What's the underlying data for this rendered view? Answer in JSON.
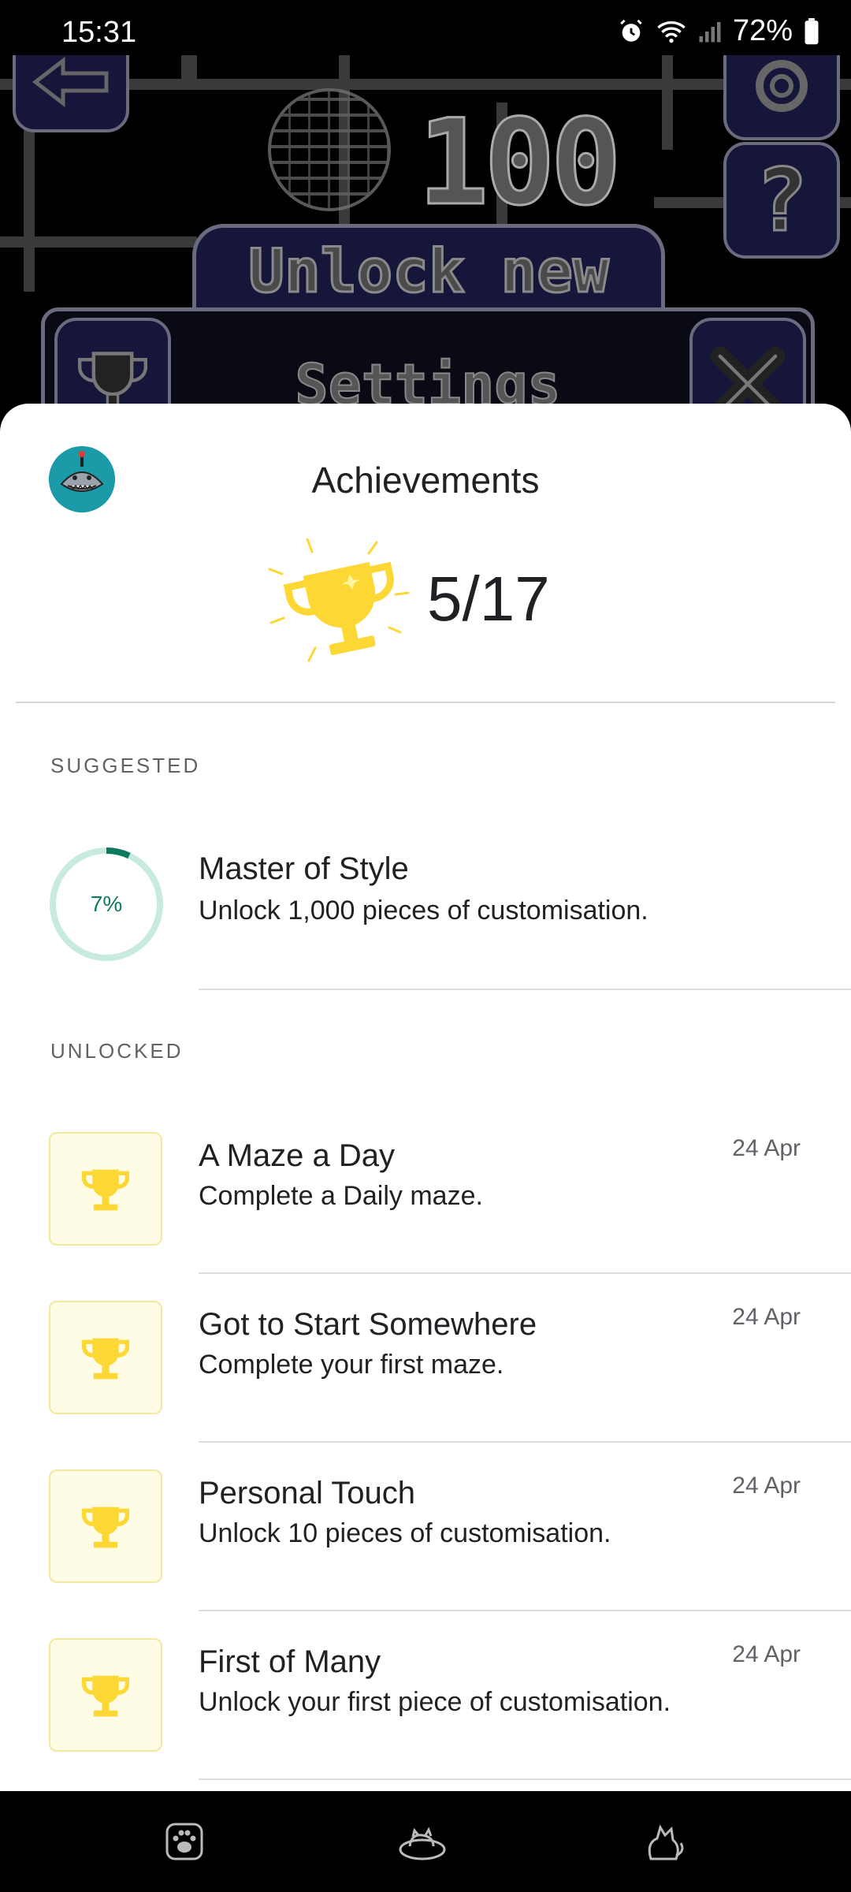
{
  "status_bar": {
    "time": "15:31",
    "battery": "72%",
    "icons": [
      "alarm-icon",
      "wifi-icon",
      "signal-icon",
      "battery-icon"
    ]
  },
  "background_game": {
    "score": "100",
    "banner_text": "Unlock new",
    "panel_title": "Settings",
    "icons": [
      "back-arrow-icon",
      "maze-icon",
      "gear-icon",
      "help-icon",
      "trophy-icon",
      "close-icon"
    ]
  },
  "achievements_sheet": {
    "title": "Achievements",
    "score": "5/17",
    "sections": {
      "suggested_label": "SUGGESTED",
      "unlocked_label": "UNLOCKED"
    },
    "suggested": [
      {
        "title": "Master of Style",
        "description": "Unlock 1,000 pieces of customisation.",
        "progress_label": "7%",
        "progress": 0.07
      }
    ],
    "unlocked": [
      {
        "title": "A Maze a Day",
        "description": "Complete a Daily maze.",
        "date": "24 Apr"
      },
      {
        "title": "Got to Start Somewhere",
        "description": "Complete your first maze.",
        "date": "24 Apr"
      },
      {
        "title": "Personal Touch",
        "description": "Unlock 10 pieces of customisation.",
        "date": "24 Apr"
      },
      {
        "title": "First of Many",
        "description": "Unlock your first piece of customisation.",
        "date": "24 Apr"
      }
    ]
  },
  "nav_bar": {
    "icons": [
      "paw-icon",
      "cat-bed-icon",
      "cat-icon"
    ]
  },
  "colors": {
    "trophy": "#fdd835",
    "progress": "#0d7a5f",
    "progress_track": "#c8eadf",
    "sheet_bg": "#ffffff"
  }
}
